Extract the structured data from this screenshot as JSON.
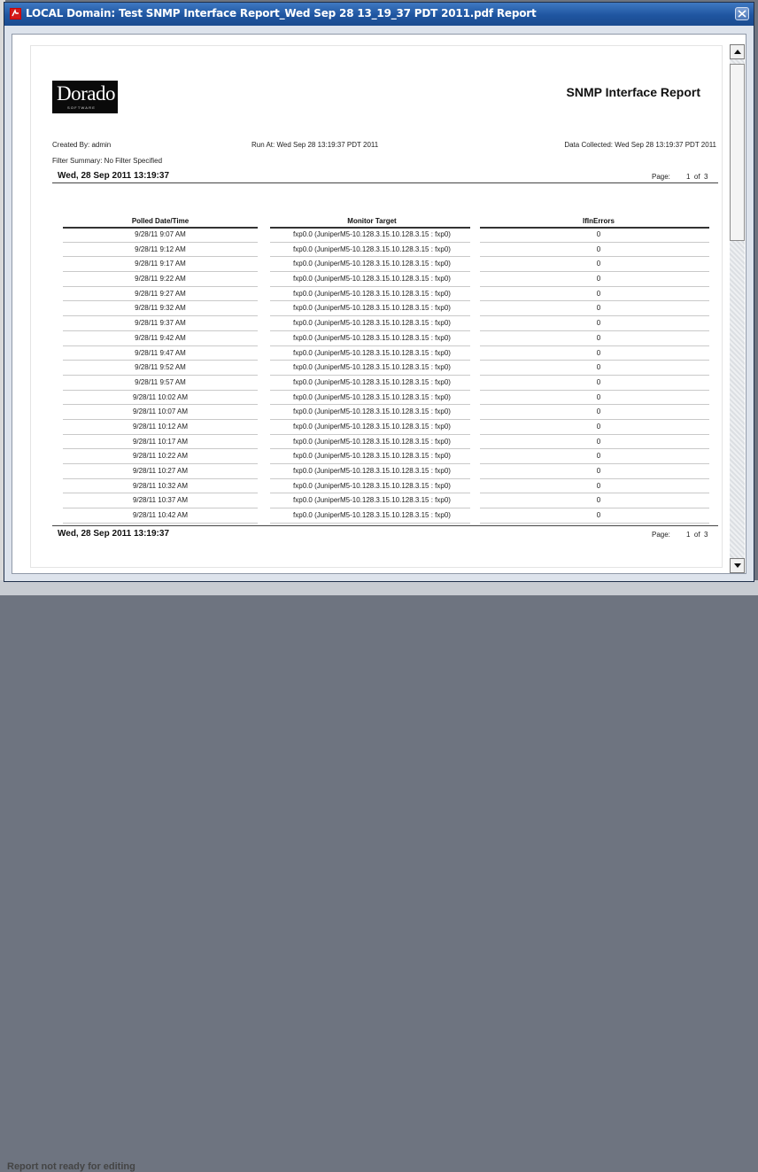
{
  "window": {
    "title": "LOCAL Domain: Test SNMP Interface Report_Wed Sep 28 13_19_37 PDT 2011.pdf Report",
    "title_icon": "pdf-icon",
    "close_icon": "close-icon"
  },
  "background": {
    "status_text": "Report not ready for editing"
  },
  "report": {
    "logo_text": "Dorado",
    "logo_subtext": "SOFTWARE",
    "title": "SNMP Interface Report",
    "created_by": "Created By: admin",
    "run_at": "Run At: Wed Sep 28 13:19:37 PDT 2011",
    "data_collected": "Data Collected: Wed Sep 28 13:19:37 PDT 2011",
    "filter_summary": "Filter Summary: No Filter Specified",
    "header_date": "Wed, 28 Sep 2011 13:19:37",
    "footer_date": "Wed, 28 Sep 2011 13:19:37",
    "page_label": "Page:",
    "page_value": "1  of  3",
    "columns": [
      "Polled Date/Time",
      "Monitor Target",
      "IfInErrors"
    ],
    "rows": [
      [
        "9/28/11 9:07 AM",
        "fxp0.0 (JuniperM5-10.128.3.15.10.128.3.15 : fxp0)",
        "0"
      ],
      [
        "9/28/11 9:12 AM",
        "fxp0.0 (JuniperM5-10.128.3.15.10.128.3.15 : fxp0)",
        "0"
      ],
      [
        "9/28/11 9:17 AM",
        "fxp0.0 (JuniperM5-10.128.3.15.10.128.3.15 : fxp0)",
        "0"
      ],
      [
        "9/28/11 9:22 AM",
        "fxp0.0 (JuniperM5-10.128.3.15.10.128.3.15 : fxp0)",
        "0"
      ],
      [
        "9/28/11 9:27 AM",
        "fxp0.0 (JuniperM5-10.128.3.15.10.128.3.15 : fxp0)",
        "0"
      ],
      [
        "9/28/11 9:32 AM",
        "fxp0.0 (JuniperM5-10.128.3.15.10.128.3.15 : fxp0)",
        "0"
      ],
      [
        "9/28/11 9:37 AM",
        "fxp0.0 (JuniperM5-10.128.3.15.10.128.3.15 : fxp0)",
        "0"
      ],
      [
        "9/28/11 9:42 AM",
        "fxp0.0 (JuniperM5-10.128.3.15.10.128.3.15 : fxp0)",
        "0"
      ],
      [
        "9/28/11 9:47 AM",
        "fxp0.0 (JuniperM5-10.128.3.15.10.128.3.15 : fxp0)",
        "0"
      ],
      [
        "9/28/11 9:52 AM",
        "fxp0.0 (JuniperM5-10.128.3.15.10.128.3.15 : fxp0)",
        "0"
      ],
      [
        "9/28/11 9:57 AM",
        "fxp0.0 (JuniperM5-10.128.3.15.10.128.3.15 : fxp0)",
        "0"
      ],
      [
        "9/28/11 10:02 AM",
        "fxp0.0 (JuniperM5-10.128.3.15.10.128.3.15 : fxp0)",
        "0"
      ],
      [
        "9/28/11 10:07 AM",
        "fxp0.0 (JuniperM5-10.128.3.15.10.128.3.15 : fxp0)",
        "0"
      ],
      [
        "9/28/11 10:12 AM",
        "fxp0.0 (JuniperM5-10.128.3.15.10.128.3.15 : fxp0)",
        "0"
      ],
      [
        "9/28/11 10:17 AM",
        "fxp0.0 (JuniperM5-10.128.3.15.10.128.3.15 : fxp0)",
        "0"
      ],
      [
        "9/28/11 10:22 AM",
        "fxp0.0 (JuniperM5-10.128.3.15.10.128.3.15 : fxp0)",
        "0"
      ],
      [
        "9/28/11 10:27 AM",
        "fxp0.0 (JuniperM5-10.128.3.15.10.128.3.15 : fxp0)",
        "0"
      ],
      [
        "9/28/11 10:32 AM",
        "fxp0.0 (JuniperM5-10.128.3.15.10.128.3.15 : fxp0)",
        "0"
      ],
      [
        "9/28/11 10:37 AM",
        "fxp0.0 (JuniperM5-10.128.3.15.10.128.3.15 : fxp0)",
        "0"
      ],
      [
        "9/28/11 10:42 AM",
        "fxp0.0 (JuniperM5-10.128.3.15.10.128.3.15 : fxp0)",
        "0"
      ]
    ]
  },
  "scrollbar": {
    "up_icon": "scroll-up-arrow-icon",
    "down_icon": "scroll-down-arrow-icon"
  },
  "colors": {
    "titlebar": "#1f55a0",
    "dialog_bg": "#dde3ec",
    "page_bg": "#ffffff"
  }
}
